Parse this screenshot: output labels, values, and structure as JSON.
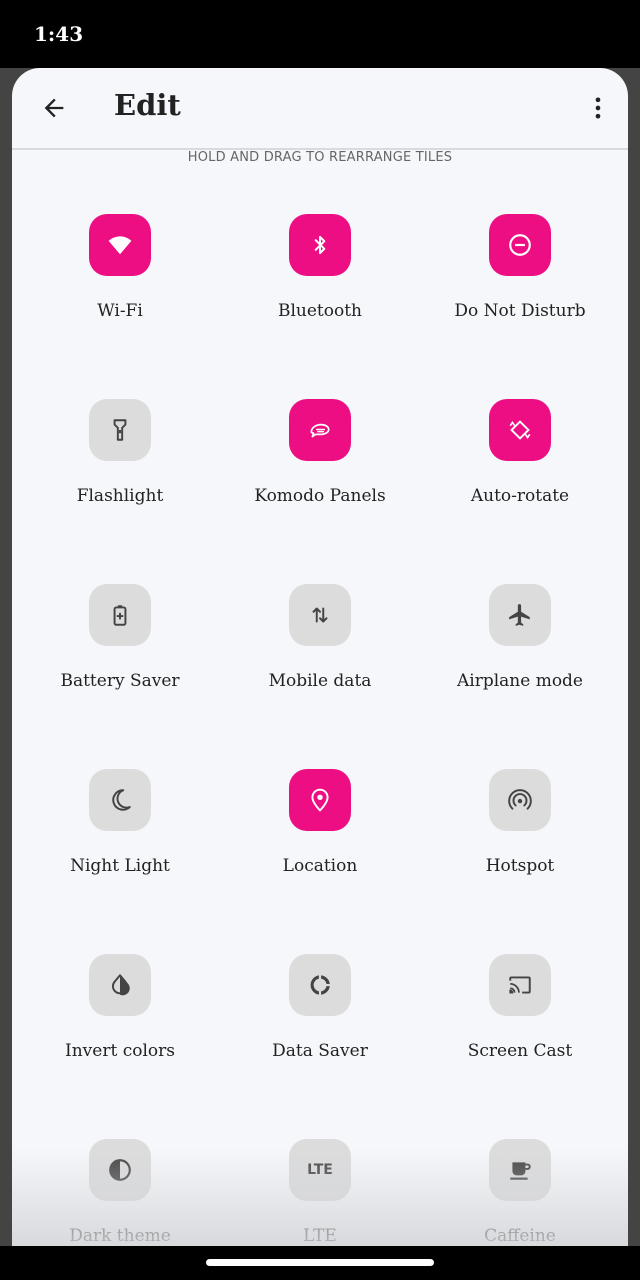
{
  "status_bar": {
    "time": "1:43"
  },
  "toolbar": {
    "title": "Edit",
    "back_icon": "arrow-left-icon",
    "more_icon": "more-vertical-icon"
  },
  "hint": "HOLD AND DRAG TO REARRANGE TILES",
  "colors": {
    "accent": "#ee0e84",
    "tile_off": "#dcdcdd",
    "icon_off": "#444444",
    "sheet_bg": "#f5f7fa"
  },
  "tiles": [
    {
      "label": "Wi-Fi",
      "icon": "wifi-icon",
      "active": true
    },
    {
      "label": "Bluetooth",
      "icon": "bluetooth-icon",
      "active": true
    },
    {
      "label": "Do Not Disturb",
      "icon": "do-not-disturb-icon",
      "active": true
    },
    {
      "label": "Flashlight",
      "icon": "flashlight-icon",
      "active": false
    },
    {
      "label": "Komodo Panels",
      "icon": "komodo-panels-icon",
      "active": true
    },
    {
      "label": "Auto-rotate",
      "icon": "auto-rotate-icon",
      "active": true
    },
    {
      "label": "Battery Saver",
      "icon": "battery-saver-icon",
      "active": false
    },
    {
      "label": "Mobile data",
      "icon": "mobile-data-icon",
      "active": false
    },
    {
      "label": "Airplane mode",
      "icon": "airplane-icon",
      "active": false
    },
    {
      "label": "Night Light",
      "icon": "night-light-icon",
      "active": false
    },
    {
      "label": "Location",
      "icon": "location-icon",
      "active": true
    },
    {
      "label": "Hotspot",
      "icon": "hotspot-icon",
      "active": false
    },
    {
      "label": "Invert colors",
      "icon": "invert-colors-icon",
      "active": false
    },
    {
      "label": "Data Saver",
      "icon": "data-saver-icon",
      "active": false
    },
    {
      "label": "Screen Cast",
      "icon": "screen-cast-icon",
      "active": false
    },
    {
      "label": "Dark theme",
      "icon": "dark-theme-icon",
      "active": false
    },
    {
      "label": "LTE",
      "icon": "lte-icon",
      "active": false,
      "icon_text": "LTE"
    },
    {
      "label": "Caffeine",
      "icon": "caffeine-icon",
      "active": false
    }
  ]
}
